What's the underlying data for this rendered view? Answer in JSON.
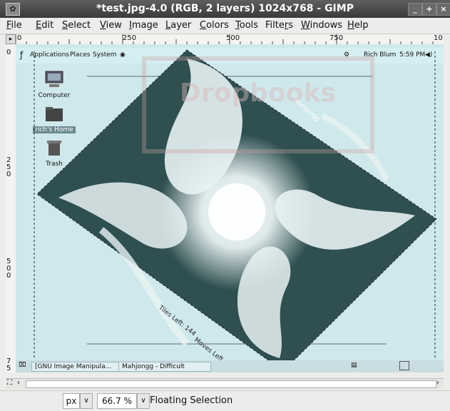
{
  "window": {
    "title": "*test.jpg-4.0 (RGB, 2 layers) 1024x768 - GIMP",
    "minimize": "_",
    "maximize": "+",
    "close": "×"
  },
  "menu": [
    {
      "label": "File",
      "u": "F",
      "rest": "ile"
    },
    {
      "label": "Edit",
      "u": "E",
      "rest": "dit"
    },
    {
      "label": "Select",
      "u": "S",
      "rest": "elect"
    },
    {
      "label": "View",
      "u": "V",
      "rest": "iew"
    },
    {
      "label": "Image",
      "u": "I",
      "rest": "mage"
    },
    {
      "label": "Layer",
      "u": "L",
      "rest": "ayer"
    },
    {
      "label": "Colors",
      "u": "C",
      "rest": "olors"
    },
    {
      "label": "Tools",
      "u": "T",
      "rest": "ools"
    },
    {
      "label": "Filters",
      "u": "r",
      "pre": "Filte",
      "rest": "s"
    },
    {
      "label": "Windows",
      "u": "W",
      "rest": "indows"
    },
    {
      "label": "Help",
      "u": "H",
      "rest": "elp"
    }
  ],
  "ruler": {
    "h_labels": [
      "0",
      "250",
      "500",
      "750",
      "10"
    ],
    "v_labels": [
      "0",
      "250",
      "500",
      "75"
    ]
  },
  "desktop": {
    "panel_items": [
      "Applications",
      "Places",
      "System"
    ],
    "user": "Rich Blum",
    "clock": "5:59 PM",
    "icons": [
      "Computer",
      "rich's Home",
      "Trash"
    ],
    "taskbar": [
      "[GNU Image Manipula...",
      "Mahjongg - Difficult"
    ],
    "image_texts": [
      "Tiles Left: 144",
      "Moves Left",
      "Mahjongg"
    ],
    "watermark": "Dropbooks"
  },
  "status": {
    "unit": "px",
    "zoom": "66.7 %",
    "message": "Floating Selection"
  },
  "colors": {
    "canvas_bg": "#cfe8ec",
    "swirl_dark": "#2f4f50",
    "swirl_light": "#e8f2f3",
    "titlebar": "#4a4a4a"
  }
}
